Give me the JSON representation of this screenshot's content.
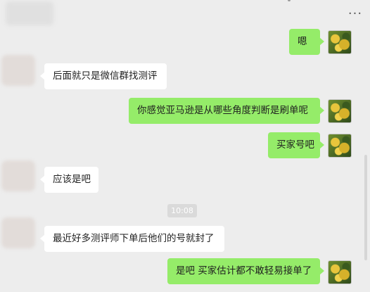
{
  "header": {
    "more_icon": "more-icon",
    "more_glyph": "···"
  },
  "messages": [
    {
      "sender": "self",
      "text": "嗯"
    },
    {
      "sender": "other",
      "text": "后面就只是微信群找测评"
    },
    {
      "sender": "self",
      "text": "你感觉亚马逊是从哪些角度判断是刷单呢"
    },
    {
      "sender": "self",
      "text": "买家号吧"
    },
    {
      "sender": "other",
      "text": "应该是吧"
    },
    {
      "sender": "other",
      "text": "最近好多测评师下单后他们的号就封了"
    },
    {
      "sender": "self",
      "text": "是吧 买家估计都不敢轻易接单了"
    }
  ],
  "timestamp": "10:08",
  "colors": {
    "background": "#ededed",
    "self_bubble": "#95ec69",
    "other_bubble": "#ffffff",
    "timestamp_bg": "#dadada"
  }
}
